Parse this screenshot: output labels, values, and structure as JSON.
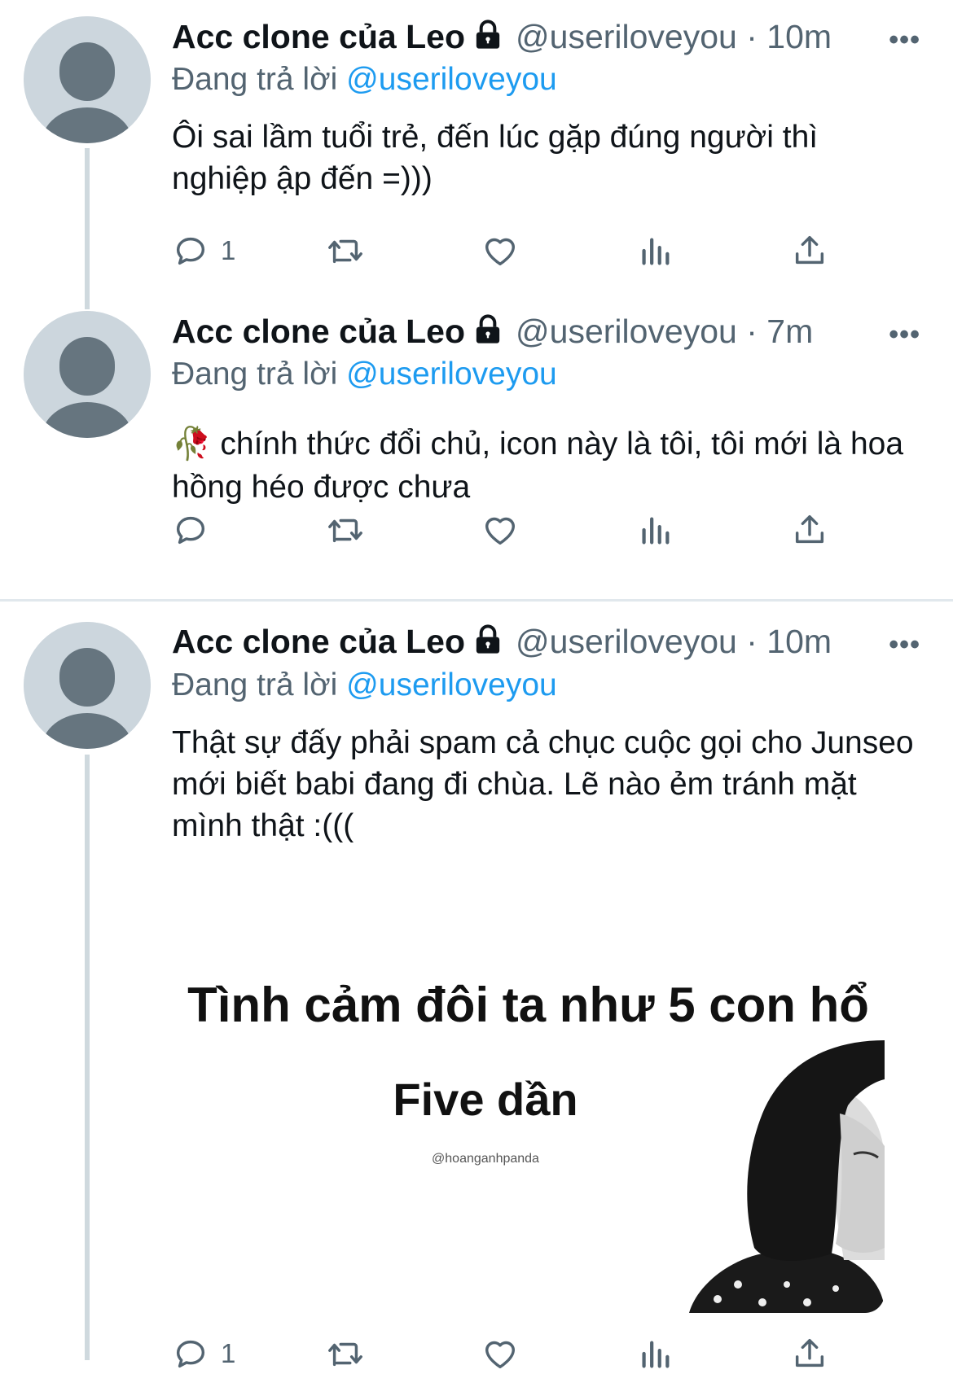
{
  "tweets": [
    {
      "name": "Acc clone của Leo",
      "handle": "@useriloveyou",
      "separator": " · ",
      "time": "10m",
      "more": "•••",
      "reply_prefix": "Đang trả lời ",
      "reply_mention": "@useriloveyou",
      "text": "Ôi sai lầm tuổi trẻ, đến lúc gặp đúng người thì nghiệp ập đến =)))",
      "reply_count": "1"
    },
    {
      "name": "Acc clone của Leo",
      "handle": "@useriloveyou",
      "separator": " · ",
      "time": "7m",
      "more": "•••",
      "reply_prefix": "Đang trả lời ",
      "reply_mention": "@useriloveyou",
      "text": "🥀 chính thức đổi chủ, icon này là tôi, tôi mới là hoa hồng héo được chưa",
      "reply_count": ""
    },
    {
      "name": "Acc clone của Leo",
      "handle": "@useriloveyou",
      "separator": " · ",
      "time": "10m",
      "more": "•••",
      "reply_prefix": "Đang trả lời ",
      "reply_mention": "@useriloveyou",
      "text": "Thật sự đấy phải spam cả chục cuộc gọi cho Junseo mới biết babi đang đi chùa. Lẽ nào ẻm tránh mặt mình thật :(((",
      "reply_count": "1",
      "media": {
        "title": "Tình cảm đôi ta như 5 con hổ",
        "subtitle": "Five dần",
        "credit": "@hoanganhpanda"
      }
    }
  ],
  "colors": {
    "accent": "#1d9bf0",
    "secondary_text": "#536471",
    "avatar_bg": "#ccd6dd",
    "avatar_fg": "#66757f"
  },
  "icons": [
    "lock-icon",
    "reply-icon",
    "retweet-icon",
    "like-icon",
    "views-icon",
    "share-icon"
  ]
}
